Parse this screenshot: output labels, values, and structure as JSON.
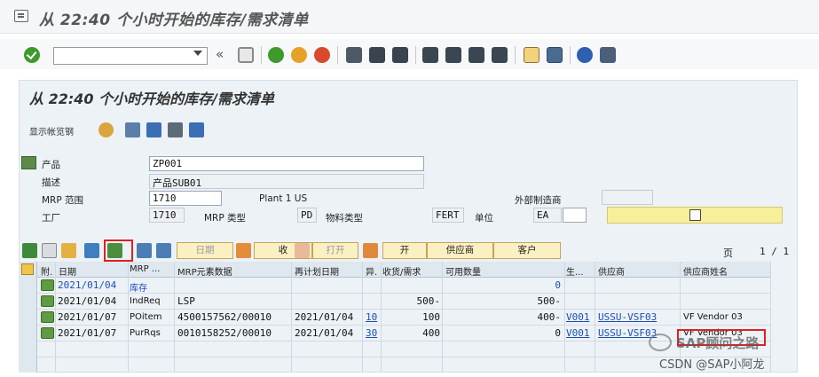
{
  "window": {
    "title": "从 22:40 个小时开始的库存/需求清单"
  },
  "toolbar": {
    "command_value": "",
    "back_symbol": "«"
  },
  "panel": {
    "title": "从 22:40 个小时开始的库存/需求清单",
    "app_toolbar_label": "显示帐览钢"
  },
  "header": {
    "product_label": "产品",
    "product_value": "ZP001",
    "desc_label": "描述",
    "desc_value": "产品SUB01",
    "mrp_area_label": "MRP 范围",
    "mrp_area_value": "1710",
    "mrp_area_desc": "Plant 1 US",
    "external_label": "外部制造商",
    "external_value": "",
    "plant_label": "工厂",
    "plant_value": "1710",
    "mrp_type_label": "MRP 类型",
    "mrp_type_value": "PD",
    "mat_type_label": "物料类型",
    "mat_type_value": "FERT",
    "unit_label": "单位",
    "unit_value": "EA",
    "unit_extra": ""
  },
  "table_toolbar": {
    "btn_date": "日期",
    "btn_receive": "收",
    "btn_print": "打开",
    "btn_open": "开",
    "btn_vendor": "供应商",
    "btn_customer": "客户",
    "page_label": "页",
    "page_value": "1 / 1"
  },
  "table": {
    "headers": [
      "附.",
      "日期",
      "MRP ...",
      "MRP元素数据",
      "再计划日期",
      "异.",
      "收货/需求",
      "可用数量",
      "生...",
      "供应商",
      "供应商姓名"
    ],
    "rows": [
      {
        "date": "2021/01/04",
        "mrp": "库存",
        "element": "",
        "resched": "",
        "exc": "",
        "qty": "",
        "avail": "0",
        "prod": "",
        "vendor": "",
        "vendor_name": ""
      },
      {
        "date": "2021/01/04",
        "mrp": "IndReq",
        "element": "LSP",
        "resched": "",
        "exc": "",
        "qty": "500-",
        "avail": "500-",
        "prod": "",
        "vendor": "",
        "vendor_name": ""
      },
      {
        "date": "2021/01/07",
        "mrp": "POitem",
        "element": "4500157562/00010",
        "resched": "2021/01/04",
        "exc": "10",
        "qty": "100",
        "avail": "400-",
        "prod": "V001",
        "vendor": "USSU-VSF03",
        "vendor_name": "VF Vendor 03"
      },
      {
        "date": "2021/01/07",
        "mrp": "PurRqs",
        "element": "0010158252/00010",
        "resched": "2021/01/04",
        "exc": "30",
        "qty": "400",
        "avail": "0",
        "prod": "V001",
        "vendor": "USSU-VSF03",
        "vendor_name": "VF Vendor 03"
      }
    ]
  },
  "watermark": {
    "line1": "SAP顾问之路",
    "line2": "CSDN @SAP小阿龙"
  }
}
